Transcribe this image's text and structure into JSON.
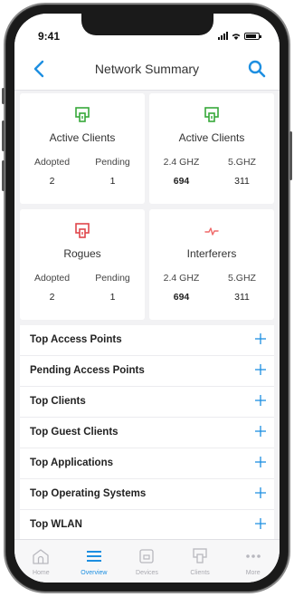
{
  "status_bar": {
    "time": "9:41"
  },
  "nav": {
    "title": "Network Summary",
    "back_icon": "chevron-left-icon",
    "search_icon": "search-icon"
  },
  "colors": {
    "accent": "#1d8fe1",
    "clients_icon": "#37a83a",
    "rogues_icon": "#e0464b",
    "interferers_icon": "#ef6a6a"
  },
  "cards": [
    {
      "title": "Active Clients",
      "icon": "access-point-icon",
      "stats": [
        {
          "label": "Adopted",
          "value": "2"
        },
        {
          "label": "Pending",
          "value": "1"
        }
      ]
    },
    {
      "title": "Active Clients",
      "icon": "access-point-icon",
      "stats": [
        {
          "label": "2.4 GHZ",
          "value": "694"
        },
        {
          "label": "5.GHZ",
          "value": "311"
        }
      ]
    },
    {
      "title": "Rogues",
      "icon": "rogue-access-point-icon",
      "stats": [
        {
          "label": "Adopted",
          "value": "2"
        },
        {
          "label": "Pending",
          "value": "1"
        }
      ]
    },
    {
      "title": "Interferers",
      "icon": "pulse-icon",
      "stats": [
        {
          "label": "2.4 GHZ",
          "value": "694"
        },
        {
          "label": "5.GHZ",
          "value": "311"
        }
      ]
    }
  ],
  "list": {
    "items": [
      {
        "label": "Top Access Points"
      },
      {
        "label": "Pending Access Points"
      },
      {
        "label": "Top Clients"
      },
      {
        "label": "Top Guest Clients"
      },
      {
        "label": "Top Applications"
      },
      {
        "label": "Top Operating Systems"
      },
      {
        "label": "Top WLAN"
      }
    ],
    "expand_icon": "plus-icon"
  },
  "tab_bar": {
    "active": "Overview",
    "tabs": [
      {
        "label": "Home",
        "icon": "home-icon"
      },
      {
        "label": "Overview",
        "icon": "menu-icon"
      },
      {
        "label": "Devices",
        "icon": "device-icon"
      },
      {
        "label": "Clients",
        "icon": "access-point-icon"
      },
      {
        "label": "More",
        "icon": "more-dots-icon"
      }
    ]
  }
}
